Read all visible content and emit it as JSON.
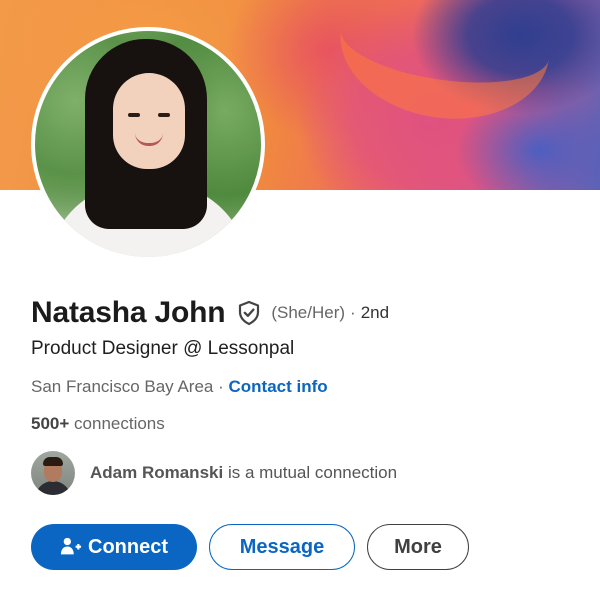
{
  "profile": {
    "name": "Natasha John",
    "pronouns": "(She/Her)",
    "separator": "·",
    "degree": "2nd",
    "headline": "Product Designer @ Lessonpal",
    "location": "San Francisco Bay Area",
    "location_separator": "·",
    "contact_info_label": "Contact info",
    "connections_count": "500+",
    "connections_label": "connections",
    "avatar_icon": "profile-photo",
    "verified_icon": "shield-check-icon"
  },
  "mutual": {
    "name": "Adam Romanski",
    "suffix": "is a mutual connection",
    "avatar_icon": "mutual-connection-photo"
  },
  "actions": {
    "connect_label": "Connect",
    "connect_icon": "add-person-icon",
    "message_label": "Message",
    "more_label": "More"
  },
  "colors": {
    "accent": "#0a66c2",
    "text_primary": "#1b1b1b",
    "text_secondary": "#666666",
    "more_border": "#404040"
  }
}
